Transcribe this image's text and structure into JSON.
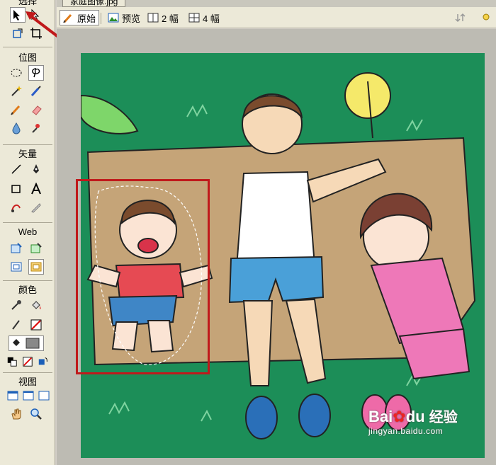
{
  "document": {
    "tab_title": "家庭图像.jpg"
  },
  "view_toolbar": {
    "original_label": "原始",
    "preview_label": "预览",
    "two_up_label": "2 幅",
    "four_up_label": "4 幅"
  },
  "tools_panel": {
    "select_title": "选择",
    "bitmap_title": "位图",
    "vector_title": "矢量",
    "web_title": "Web",
    "colors_title": "颜色",
    "view_title": "视图"
  },
  "watermark": {
    "logo": "Bai",
    "logo_suffix": "du",
    "brand": "经验",
    "url": "jingyan.baidu.com"
  },
  "colors": {
    "selection_box": "#c0191b",
    "arrow": "#c0191b",
    "canvas_bg": "#1c8e58"
  }
}
